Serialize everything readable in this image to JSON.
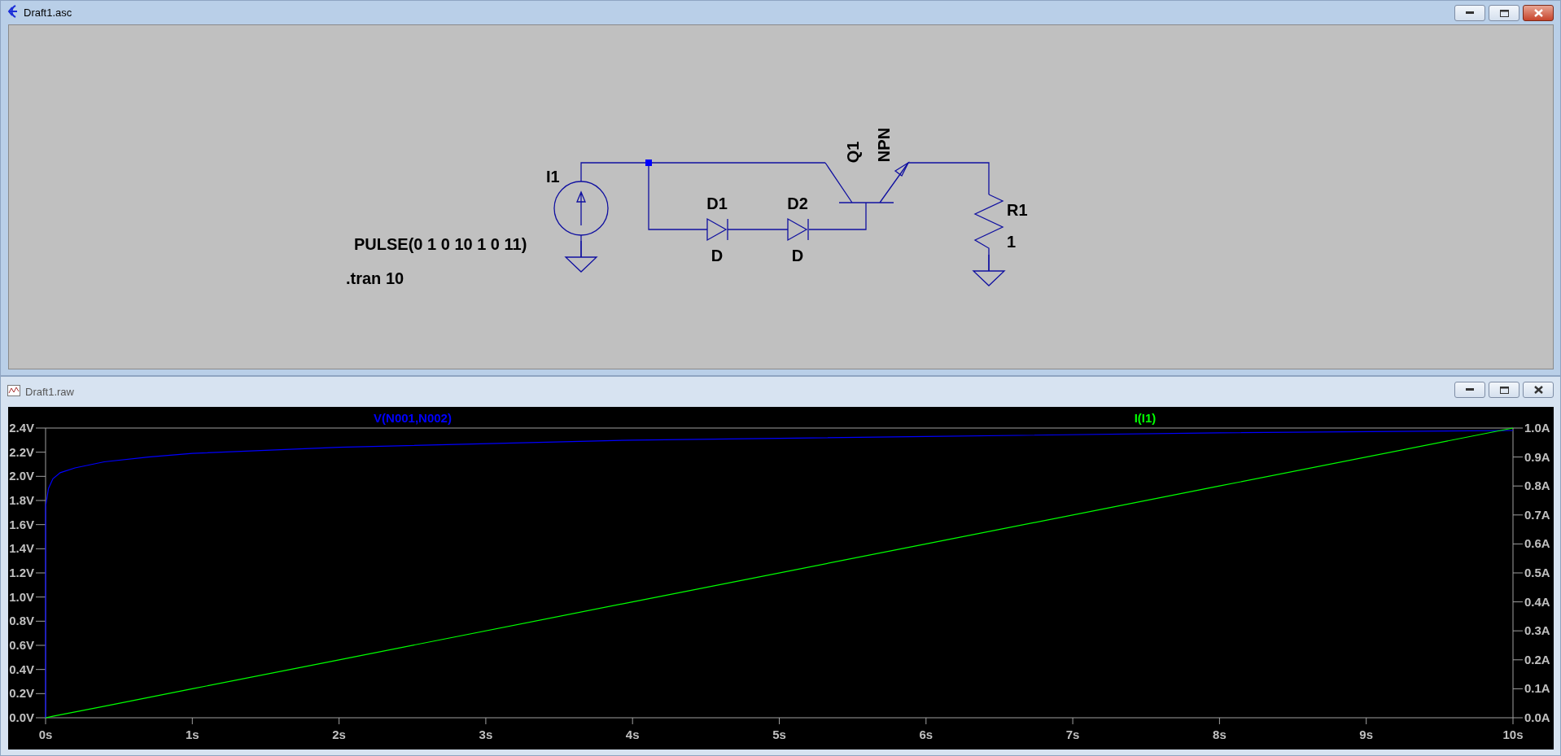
{
  "schematic_window": {
    "title": "Draft1.asc",
    "active": true,
    "components": [
      {
        "kind": "current-source",
        "ref": "I1",
        "value": "PULSE(0 1 0 10 1 0 11)"
      },
      {
        "kind": "diode",
        "ref": "D1",
        "value": "D"
      },
      {
        "kind": "diode",
        "ref": "D2",
        "value": "D"
      },
      {
        "kind": "npn",
        "ref": "Q1",
        "value": "NPN"
      },
      {
        "kind": "resistor",
        "ref": "R1",
        "value": "1"
      }
    ],
    "directives": [
      ".tran 10"
    ]
  },
  "waveform_window": {
    "title": "Draft1.raw",
    "active": false,
    "chart_data": {
      "type": "line",
      "x": [
        0,
        0,
        0.02,
        0.05,
        0.1,
        0.2,
        0.4,
        0.7,
        1,
        2,
        4,
        6,
        8,
        10
      ],
      "series": [
        {
          "name": "V(N001,N002)",
          "color": "#0000ff",
          "axis": "y",
          "values": [
            0,
            1.75,
            1.9,
            1.98,
            2.03,
            2.07,
            2.12,
            2.16,
            2.19,
            2.24,
            2.3,
            2.33,
            2.36,
            2.38
          ]
        },
        {
          "name": "I(I1)",
          "color": "#00ff00",
          "axis": "y2",
          "values": [
            0,
            0,
            0.002,
            0.005,
            0.01,
            0.02,
            0.04,
            0.07,
            0.1,
            0.2,
            0.4,
            0.6,
            0.8,
            1
          ]
        }
      ],
      "xlim": [
        0,
        10
      ],
      "ylim": [
        0,
        2.4
      ],
      "y2lim": [
        0,
        1
      ],
      "xticks": [
        {
          "value": 0,
          "label": "0s"
        },
        {
          "value": 1,
          "label": "1s"
        },
        {
          "value": 2,
          "label": "2s"
        },
        {
          "value": 3,
          "label": "3s"
        },
        {
          "value": 4,
          "label": "4s"
        },
        {
          "value": 5,
          "label": "5s"
        },
        {
          "value": 6,
          "label": "6s"
        },
        {
          "value": 7,
          "label": "7s"
        },
        {
          "value": 8,
          "label": "8s"
        },
        {
          "value": 9,
          "label": "9s"
        },
        {
          "value": 10,
          "label": "10s"
        }
      ],
      "yticks": [
        {
          "value": 0,
          "label": "0.0V"
        },
        {
          "value": 0.2,
          "label": "0.2V"
        },
        {
          "value": 0.4,
          "label": "0.4V"
        },
        {
          "value": 0.6,
          "label": "0.6V"
        },
        {
          "value": 0.8,
          "label": "0.8V"
        },
        {
          "value": 1,
          "label": "1.0V"
        },
        {
          "value": 1.2,
          "label": "1.2V"
        },
        {
          "value": 1.4,
          "label": "1.4V"
        },
        {
          "value": 1.6,
          "label": "1.6V"
        },
        {
          "value": 1.8,
          "label": "1.8V"
        },
        {
          "value": 2,
          "label": "2.0V"
        },
        {
          "value": 2.2,
          "label": "2.2V"
        },
        {
          "value": 2.4,
          "label": "2.4V"
        }
      ],
      "y2ticks": [
        {
          "value": 0,
          "label": "0.0A"
        },
        {
          "value": 0.1,
          "label": "0.1A"
        },
        {
          "value": 0.2,
          "label": "0.2A"
        },
        {
          "value": 0.3,
          "label": "0.3A"
        },
        {
          "value": 0.4,
          "label": "0.4A"
        },
        {
          "value": 0.5,
          "label": "0.5A"
        },
        {
          "value": 0.6,
          "label": "0.6A"
        },
        {
          "value": 0.7,
          "label": "0.7A"
        },
        {
          "value": 0.8,
          "label": "0.8A"
        },
        {
          "value": 0.9,
          "label": "0.9A"
        },
        {
          "value": 1,
          "label": "1.0A"
        }
      ]
    }
  }
}
